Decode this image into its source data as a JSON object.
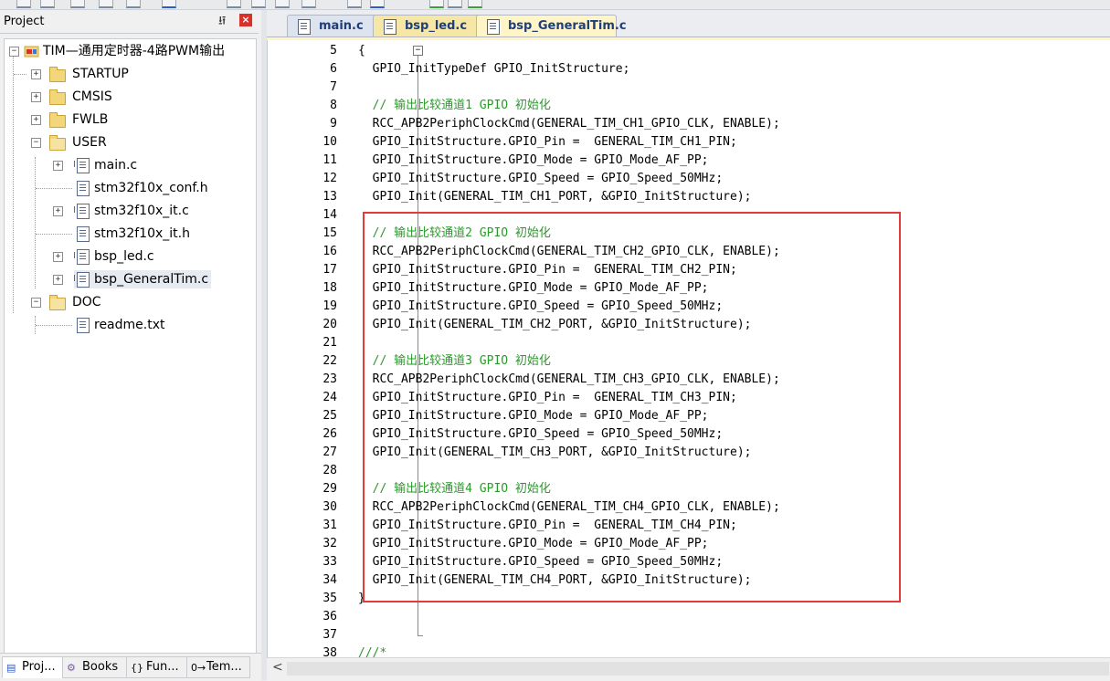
{
  "project_panel": {
    "title": "Project",
    "pin": "✕",
    "pin_symbol": "⭿",
    "close": "×",
    "root": "TIM—通用定时器-4路PWM输出",
    "groups": [
      {
        "label": "STARTUP",
        "expanded": false
      },
      {
        "label": "CMSIS",
        "expanded": false
      },
      {
        "label": "FWLB",
        "expanded": false
      },
      {
        "label": "USER",
        "expanded": true
      },
      {
        "label": "DOC",
        "expanded": true
      }
    ],
    "user_files": [
      {
        "label": "main.c",
        "expandable": true
      },
      {
        "label": "stm32f10x_conf.h",
        "expandable": false
      },
      {
        "label": "stm32f10x_it.c",
        "expandable": true
      },
      {
        "label": "stm32f10x_it.h",
        "expandable": false
      },
      {
        "label": "bsp_led.c",
        "expandable": true
      },
      {
        "label": "bsp_GeneralTim.c",
        "expandable": true
      }
    ],
    "doc_files": [
      {
        "label": "readme.txt"
      }
    ],
    "bottom_tabs": [
      "Proj...",
      "Books",
      "Fun...",
      "Tem..."
    ],
    "bottom_tab_icons": [
      "▤",
      "⚙",
      "{}",
      "0→"
    ]
  },
  "editor": {
    "tabs": [
      {
        "label": "main.c"
      },
      {
        "label": "bsp_led.c"
      },
      {
        "label": "bsp_GeneralTim.c",
        "active": true
      }
    ],
    "fold_open": "−",
    "lines": [
      {
        "n": "5",
        "text": "{"
      },
      {
        "n": "6",
        "text": "  GPIO_InitTypeDef GPIO_InitStructure;"
      },
      {
        "n": "7",
        "text": ""
      },
      {
        "n": "8",
        "text": "  // 输出比较通道1 GPIO 初始化",
        "comment": true
      },
      {
        "n": "9",
        "text": "  RCC_APB2PeriphClockCmd(GENERAL_TIM_CH1_GPIO_CLK, ENABLE);"
      },
      {
        "n": "10",
        "text": "  GPIO_InitStructure.GPIO_Pin =  GENERAL_TIM_CH1_PIN;"
      },
      {
        "n": "11",
        "text": "  GPIO_InitStructure.GPIO_Mode = GPIO_Mode_AF_PP;"
      },
      {
        "n": "12",
        "text": "  GPIO_InitStructure.GPIO_Speed = GPIO_Speed_50MHz;"
      },
      {
        "n": "13",
        "text": "  GPIO_Init(GENERAL_TIM_CH1_PORT, &GPIO_InitStructure);"
      },
      {
        "n": "14",
        "text": ""
      },
      {
        "n": "15",
        "text": "  // 输出比较通道2 GPIO 初始化",
        "comment": true
      },
      {
        "n": "16",
        "text": "  RCC_APB2PeriphClockCmd(GENERAL_TIM_CH2_GPIO_CLK, ENABLE);"
      },
      {
        "n": "17",
        "text": "  GPIO_InitStructure.GPIO_Pin =  GENERAL_TIM_CH2_PIN;"
      },
      {
        "n": "18",
        "text": "  GPIO_InitStructure.GPIO_Mode = GPIO_Mode_AF_PP;"
      },
      {
        "n": "19",
        "text": "  GPIO_InitStructure.GPIO_Speed = GPIO_Speed_50MHz;"
      },
      {
        "n": "20",
        "text": "  GPIO_Init(GENERAL_TIM_CH2_PORT, &GPIO_InitStructure);"
      },
      {
        "n": "21",
        "text": ""
      },
      {
        "n": "22",
        "text": "  // 输出比较通道3 GPIO 初始化",
        "comment": true
      },
      {
        "n": "23",
        "text": "  RCC_APB2PeriphClockCmd(GENERAL_TIM_CH3_GPIO_CLK, ENABLE);"
      },
      {
        "n": "24",
        "text": "  GPIO_InitStructure.GPIO_Pin =  GENERAL_TIM_CH3_PIN;"
      },
      {
        "n": "25",
        "text": "  GPIO_InitStructure.GPIO_Mode = GPIO_Mode_AF_PP;"
      },
      {
        "n": "26",
        "text": "  GPIO_InitStructure.GPIO_Speed = GPIO_Speed_50MHz;"
      },
      {
        "n": "27",
        "text": "  GPIO_Init(GENERAL_TIM_CH3_PORT, &GPIO_InitStructure);"
      },
      {
        "n": "28",
        "text": ""
      },
      {
        "n": "29",
        "text": "  // 输出比较通道4 GPIO 初始化",
        "comment": true
      },
      {
        "n": "30",
        "text": "  RCC_APB2PeriphClockCmd(GENERAL_TIM_CH4_GPIO_CLK, ENABLE);"
      },
      {
        "n": "31",
        "text": "  GPIO_InitStructure.GPIO_Pin =  GENERAL_TIM_CH4_PIN;"
      },
      {
        "n": "32",
        "text": "  GPIO_InitStructure.GPIO_Mode = GPIO_Mode_AF_PP;"
      },
      {
        "n": "33",
        "text": "  GPIO_InitStructure.GPIO_Speed = GPIO_Speed_50MHz;"
      },
      {
        "n": "34",
        "text": "  GPIO_Init(GENERAL_TIM_CH4_PORT, &GPIO_InitStructure);"
      },
      {
        "n": "35",
        "text": "}"
      },
      {
        "n": "36",
        "text": ""
      },
      {
        "n": "37",
        "text": ""
      },
      {
        "n": "38",
        "text": "///*",
        "comment": true
      }
    ],
    "highlight_color": "#e43a3a",
    "comment_color": "#2a9a2a"
  },
  "scrollbar": {
    "left_arrow": "<"
  }
}
